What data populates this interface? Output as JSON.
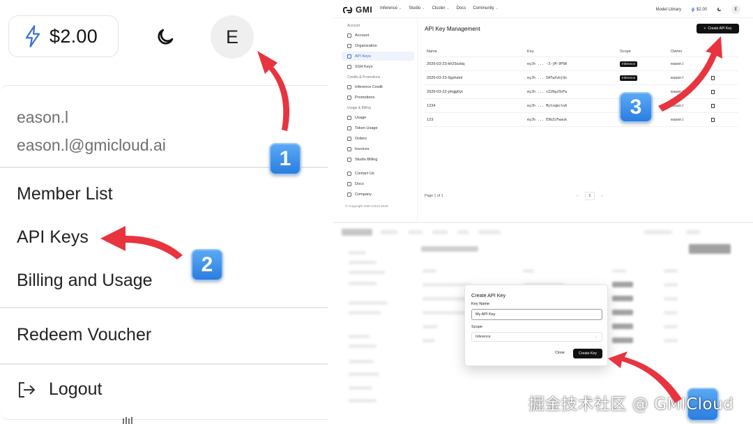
{
  "colors": {
    "accent_red": "#e8343f",
    "badge_blue": "#2b7de0",
    "active_blue": "#3c68c8",
    "button_black": "#111111"
  },
  "zoom_panel": {
    "credit": "$2.00",
    "credit_icon": "bolt-icon",
    "theme_icon": "moon-icon",
    "avatar_letter": "E",
    "user_name": "eason.l",
    "user_email": "eason.l@gmicloud.ai",
    "menu": [
      "Member List",
      "API Keys",
      "Billing and Usage",
      "Redeem Voucher"
    ],
    "logout": "Logout"
  },
  "steps": [
    "1",
    "2",
    "3"
  ],
  "app": {
    "brand": "GMI",
    "nav": [
      {
        "label": "Inference",
        "has_chevron": true
      },
      {
        "label": "Studio",
        "has_chevron": true
      },
      {
        "label": "Cluster",
        "has_chevron": true
      },
      {
        "label": "Docs",
        "has_chevron": false
      },
      {
        "label": "Community",
        "has_chevron": true
      }
    ],
    "model_library": "Model Library",
    "credit": "$2.00",
    "avatar_letter": "E",
    "sidebar": {
      "section_account": "Account",
      "account_items": [
        "Account",
        "Organization",
        "API Keys",
        "SSH Keys"
      ],
      "section_credits": "Credits & Promotions",
      "credit_items": [
        "Inference Credit",
        "Promotions"
      ],
      "section_usage": "Usage & Billing",
      "usage_items": [
        "Usage",
        "Token Usage",
        "Orders",
        "Invoices",
        "Studio Billing"
      ],
      "extra_items": [
        "Contact Us",
        "Docs",
        "Company"
      ],
      "copyright": "© Copyright GMI Cloud 2026"
    },
    "page_title": "API Key Management",
    "create_button": "Create API Key",
    "table": {
      "columns": [
        "Name",
        "Key",
        "Scope",
        "Owner"
      ],
      "rows": [
        {
          "name": "2026-03-23-kh29zzbq",
          "key": "eyJh ... -3-jM-9F0A",
          "scope": "Inference",
          "owner": "eason.l"
        },
        {
          "name": "2026-03-23-9gzhstnl",
          "key": "eyJh ... 5ATwXvbjQo",
          "scope": "Inference",
          "owner": "eason.l"
        },
        {
          "name": "2026-03-22-phqjg0yt",
          "key": "eyJh ... sZ20gz5hFw",
          "scope": "",
          "owner": "eason.l"
        },
        {
          "name": "1234",
          "key": "eyJh ... MytxqmctoA",
          "scope": "",
          "owner": "eason.l"
        },
        {
          "name": "123",
          "key": "eyJh ... E9bZcFwauk",
          "scope": "",
          "owner": "eason.l"
        }
      ]
    },
    "pagination": {
      "text": "Page 1 of 1",
      "current": "1"
    }
  },
  "dialog": {
    "title": "Create API Key",
    "key_name_label": "Key Name",
    "key_name_value": "My API Key",
    "scope_label": "Scope",
    "scope_value": "Inference",
    "close": "Close",
    "create": "Create Key"
  },
  "watermark": "掘金技术社区 @ GMICloud"
}
